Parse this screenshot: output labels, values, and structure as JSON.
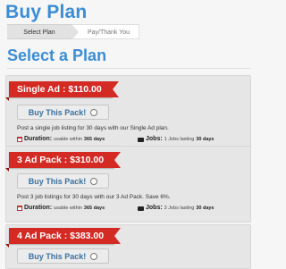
{
  "page": {
    "title": "Buy Plan",
    "steps": [
      "Select Plan",
      "Pay/Thank You"
    ],
    "section_title": "Select a Plan"
  },
  "plans": [
    {
      "ribbon": "Single Ad : $110.00",
      "button": "Buy This Pack!",
      "description": "Post a single job listing for 30 days with our Single Ad plan.",
      "duration_label": "Duration:",
      "duration_value": "usable within",
      "duration_days": "365 days",
      "jobs_label": "Jobs:",
      "jobs_value": "1 Jobs lasting",
      "jobs_days": "30 days"
    },
    {
      "ribbon": "3 Ad Pack : $310.00",
      "button": "Buy This Pack!",
      "description": "Post 3 job listings for 30 days with our 3 Ad Pack. Save 6%.",
      "duration_label": "Duration:",
      "duration_value": "usable within",
      "duration_days": "365 days",
      "jobs_label": "Jobs:",
      "jobs_value": "3 Jobs lasting",
      "jobs_days": "30 days"
    },
    {
      "ribbon": "4 Ad Pack : $383.00",
      "button": "Buy This Pack!"
    }
  ],
  "colors": {
    "heading": "#3a8dd6",
    "ribbon": "#d42a24",
    "button_text": "#3a6f9e"
  }
}
